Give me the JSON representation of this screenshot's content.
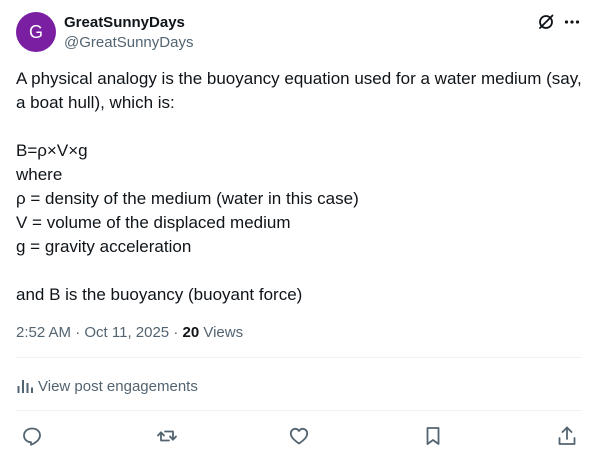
{
  "author": {
    "avatar_letter": "G",
    "avatar_color": "#7a1fa2",
    "display_name": "GreatSunnyDays",
    "handle": "@GreatSunnyDays"
  },
  "header_icons": [
    "grok-icon",
    "more-icon"
  ],
  "post": {
    "text": "A physical analogy is the buoyancy equation used for a water medium (say, a boat hull), which is:\n\nB=ρ×V×g\nwhere\nρ = density of the medium (water in this case)\nV = volume of the displaced medium\ng = gravity acceleration\n\nand B is the buoyancy (buoyant force)",
    "timestamp": "2:52 AM · Oct 11, 2025",
    "separator": " · ",
    "views_count": "20",
    "views_label": " Views"
  },
  "engagements": {
    "label": "View post engagements",
    "icon": "analytics-icon"
  },
  "actions": [
    "reply-icon",
    "repost-icon",
    "like-icon",
    "bookmark-icon",
    "share-icon"
  ],
  "colors": {
    "text_primary": "#0f1419",
    "text_secondary": "#536471",
    "divider": "#eff3f4"
  }
}
